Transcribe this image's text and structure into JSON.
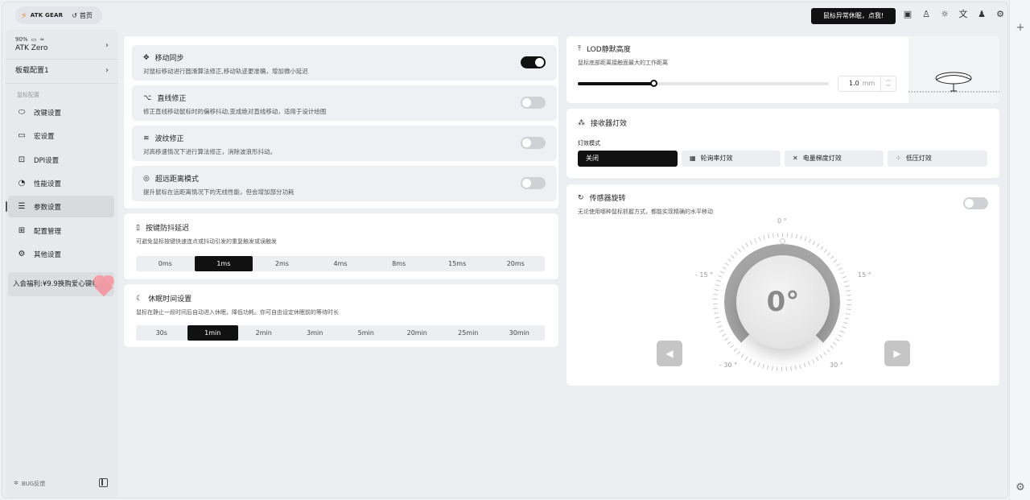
{
  "topbar": {
    "brand": "ATK GEAR",
    "home": "首页",
    "alert": "鼠标异常休眠，点我!",
    "icons": [
      "help-icon",
      "shirt-icon",
      "brightness-icon",
      "translate-icon",
      "user-icon",
      "settings-icon"
    ]
  },
  "sidebar": {
    "battery": "90%",
    "device": "ATK Zero",
    "config": "板载配置1",
    "group": "鼠标配置",
    "items": [
      {
        "label": "改键设置",
        "icon": "mouse-icon"
      },
      {
        "label": "宏设置",
        "icon": "terminal-icon"
      },
      {
        "label": "DPI设置",
        "icon": "dpi-icon"
      },
      {
        "label": "性能设置",
        "icon": "gauge-icon"
      },
      {
        "label": "参数设置",
        "icon": "sliders-icon"
      },
      {
        "label": "配置管理",
        "icon": "grid-icon"
      },
      {
        "label": "其他设置",
        "icon": "gear-icon"
      }
    ],
    "promo": "入会福利:¥9.9换购爱心键帽",
    "bug": "BUG反馈"
  },
  "left": {
    "items": [
      {
        "title": "移动同步",
        "desc": "对鼠标移动进行圆滑算法修正,移动轨迹更准确，增加微小延迟",
        "on": true
      },
      {
        "title": "直线修正",
        "desc": "修正直线移动鼠标时的偏移抖动,变成绝对直线移动，适用于设计绘图",
        "on": false
      },
      {
        "title": "波纹修正",
        "desc": "对高移速情况下进行算法修正，消除波浪形抖动。",
        "on": false
      },
      {
        "title": "超远距离模式",
        "desc": "提升鼠标在远距离情况下的无线性能，但会增加部分功耗",
        "on": false
      }
    ],
    "debounce": {
      "title": "按键防抖延迟",
      "desc": "可避免鼠标按键快速连点或抖动引发的重复触发或误触发",
      "options": [
        "0ms",
        "1ms",
        "2ms",
        "4ms",
        "8ms",
        "15ms",
        "20ms"
      ],
      "selected": "1ms"
    },
    "sleep": {
      "title": "休眠时间设置",
      "desc": "鼠标在静止一段时间后自动进入休眠，降低功耗。你可自由设定休眠前的等待时长",
      "options": [
        "30s",
        "1min",
        "2min",
        "3min",
        "5min",
        "20min",
        "25min",
        "30min"
      ],
      "selected": "1min"
    }
  },
  "lod": {
    "title": "LOD静默高度",
    "desc": "鼠标底部距离接触面最大的工作距离",
    "value": "1.0",
    "unit": "mm",
    "level": 0.3
  },
  "receiver": {
    "title": "接收器灯效",
    "mode_label": "灯效模式",
    "options": [
      {
        "label": "关闭",
        "icon": ""
      },
      {
        "label": "轮询率灯效",
        "icon": "grid-icon"
      },
      {
        "label": "电量梯度灯效",
        "icon": "close-icon"
      },
      {
        "label": "低压灯效",
        "icon": "dots-icon"
      }
    ],
    "selected": "关闭"
  },
  "sensor": {
    "title": "传感器旋转",
    "desc": "无论使用哪种鼠标抓握方式，都能实现精确的水平移动",
    "on": false,
    "value": "0°",
    "labels": {
      "top": "0 °",
      "l15": "- 15 °",
      "r15": "15 °",
      "l30": "- 30 °",
      "r30": "30 °"
    }
  }
}
